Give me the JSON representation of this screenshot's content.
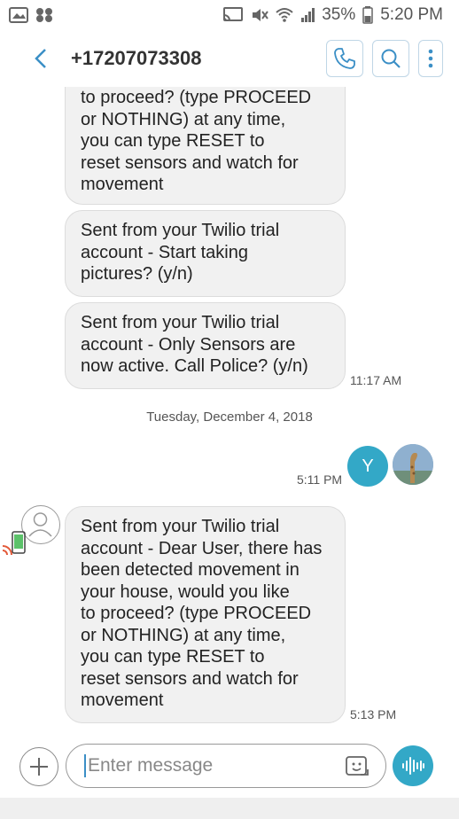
{
  "status": {
    "battery": "35%",
    "time": "5:20 PM"
  },
  "header": {
    "contact": "+17207073308"
  },
  "messages": [
    {
      "text": "to proceed? (type PROCEED\nor NOTHING) at any time,\nyou can type RESET to\nreset sensors and watch for\nmovement"
    },
    {
      "text": "Sent from your Twilio trial\naccount - Start taking\npictures? (y/n)"
    },
    {
      "text": "Sent from your Twilio trial\naccount - Only Sensors are\nnow active. Call Police? (y/n)",
      "time": "11:17 AM"
    },
    {
      "text": "Sent from your Twilio trial\naccount - Dear User, there has\nbeen detected movement in\nyour house, would you like\nto proceed? (type PROCEED\nor NOTHING) at any time,\nyou can type RESET to\nreset sensors and watch for\nmovement",
      "time": "5:13 PM"
    }
  ],
  "date_separator": "Tuesday, December 4, 2018",
  "outgoing": {
    "avatar_initial": "Y",
    "time": "5:11 PM"
  },
  "composer": {
    "placeholder": "Enter message"
  },
  "colors": {
    "accent": "#33a8c7",
    "header_icon": "#3b8fc6"
  }
}
